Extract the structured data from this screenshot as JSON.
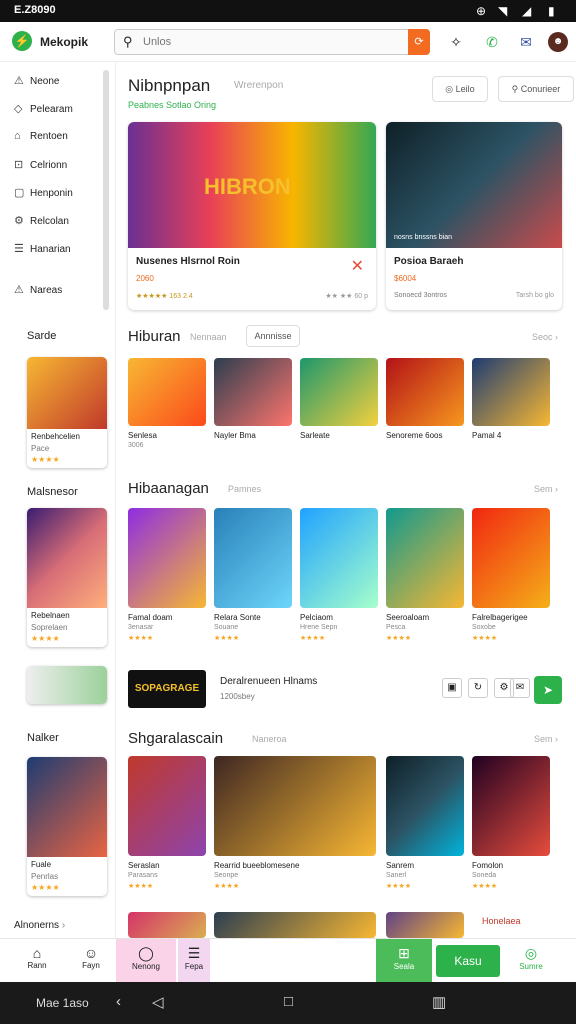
{
  "status": {
    "time": "E.Z8090"
  },
  "app": {
    "name": "Mekopik",
    "search_placeholder": "Unlos"
  },
  "sidebar": {
    "items": [
      {
        "icon": "⚠",
        "label": "Neone"
      },
      {
        "icon": "◇",
        "label": "Pelearam"
      },
      {
        "icon": "⌂",
        "label": "Rentoen"
      },
      {
        "icon": "⊡",
        "label": "Celrionn"
      },
      {
        "icon": "▢",
        "label": "Henponin"
      },
      {
        "icon": "⚙",
        "label": "Relcolan"
      },
      {
        "icon": "☰",
        "label": "Hanarian"
      },
      {
        "icon": "⚠",
        "label": "Nareas"
      }
    ],
    "sections": [
      {
        "title": "Sarde",
        "card": {
          "title": "Renbehcelien",
          "sub": "Pace",
          "stars": "★★★★"
        }
      },
      {
        "title": "Malsnesor",
        "card": {
          "title": "Rebelnaen",
          "sub": "Soprelaen",
          "stars": "★★★★"
        }
      },
      {
        "title": "Nalker",
        "card": {
          "title": "Fuale",
          "sub": "Penrlas",
          "stars": "★★★★"
        }
      }
    ],
    "footer": "Alnonerns"
  },
  "main": {
    "title": "Nibnpnpan",
    "title_sub": "Wrerenpon",
    "subline": "Peabnes Sotlao Oring",
    "btn1": "Leilo",
    "btn2": "Conurieer",
    "featured": [
      {
        "art_text": "HIBRON",
        "caption": "Nusenes Hlsrnol Roin",
        "sub": "2060",
        "meta": "★★★★★ 163 2.4",
        "right": "★★ ★★ 60 p"
      },
      {
        "art_text": "nosns bnssns bian",
        "caption": "Posioa Baraeh",
        "sub": "$6004",
        "meta": "Sonoecd 3ontros",
        "right": "Tarsh bo glo"
      }
    ],
    "section1": {
      "title": "Hiburan",
      "sub": "Nennaan",
      "chip": "Annnisse",
      "see": "Seoc",
      "games": [
        {
          "title": "Senlesa",
          "sub": "3006",
          "stars": ""
        },
        {
          "title": "Nayler Bma",
          "sub": "",
          "stars": ""
        },
        {
          "title": "Sarleate",
          "sub": "",
          "stars": ""
        },
        {
          "title": "Senoreme 6oos",
          "sub": "",
          "stars": ""
        },
        {
          "title": "Pamal 4",
          "sub": "",
          "stars": ""
        }
      ]
    },
    "section2": {
      "title": "Hibaanagan",
      "sub": "Pamnes",
      "see": "Sem",
      "games": [
        {
          "title": "Famal doam",
          "sub": "3enasar",
          "stars": "★★★★"
        },
        {
          "title": "Relara Sonte",
          "sub": "Souane",
          "stars": "★★★★"
        },
        {
          "title": "Pelciaom",
          "sub": "Hrene Sepn",
          "stars": "★★★★"
        },
        {
          "title": "Seeroaloam",
          "sub": "Pesca",
          "stars": "★★★★"
        },
        {
          "title": "Falrelbagerigee",
          "sub": "Soxobe",
          "stars": "★★★★"
        }
      ]
    },
    "banner": {
      "logo": "SOPAGRAGE",
      "title": "Deralrenueen Hlnams",
      "sub": "1200sbey"
    },
    "section3": {
      "title": "Shgaralascain",
      "sub": "Naneroa",
      "see": "Sem",
      "games": [
        {
          "title": "Seraslan",
          "sub": "Parasans",
          "stars": "★★★★"
        },
        {
          "title": "Rearrid bueeblomesene",
          "sub": "Seonpe",
          "stars": "★★★★"
        },
        {
          "title": "Sanrem",
          "sub": "Sanerl",
          "stars": "★★★★"
        },
        {
          "title": "Fomolon",
          "sub": "Soneda",
          "stars": "★★★★"
        }
      ]
    },
    "extra_label": "Honelaea"
  },
  "bottomnav": [
    {
      "icon": "⌂",
      "label": "Rann"
    },
    {
      "icon": "☺",
      "label": "Fayn"
    },
    {
      "icon": "◯",
      "label": "Nenong"
    },
    {
      "icon": "☰",
      "label": "Fepa"
    },
    {
      "icon": "⊞",
      "label": "Seala"
    },
    {
      "icon": "",
      "label": "Kasu"
    },
    {
      "icon": "◎",
      "label": "Sumre"
    }
  ],
  "sysbar": {
    "label": "Mae 1aso"
  }
}
